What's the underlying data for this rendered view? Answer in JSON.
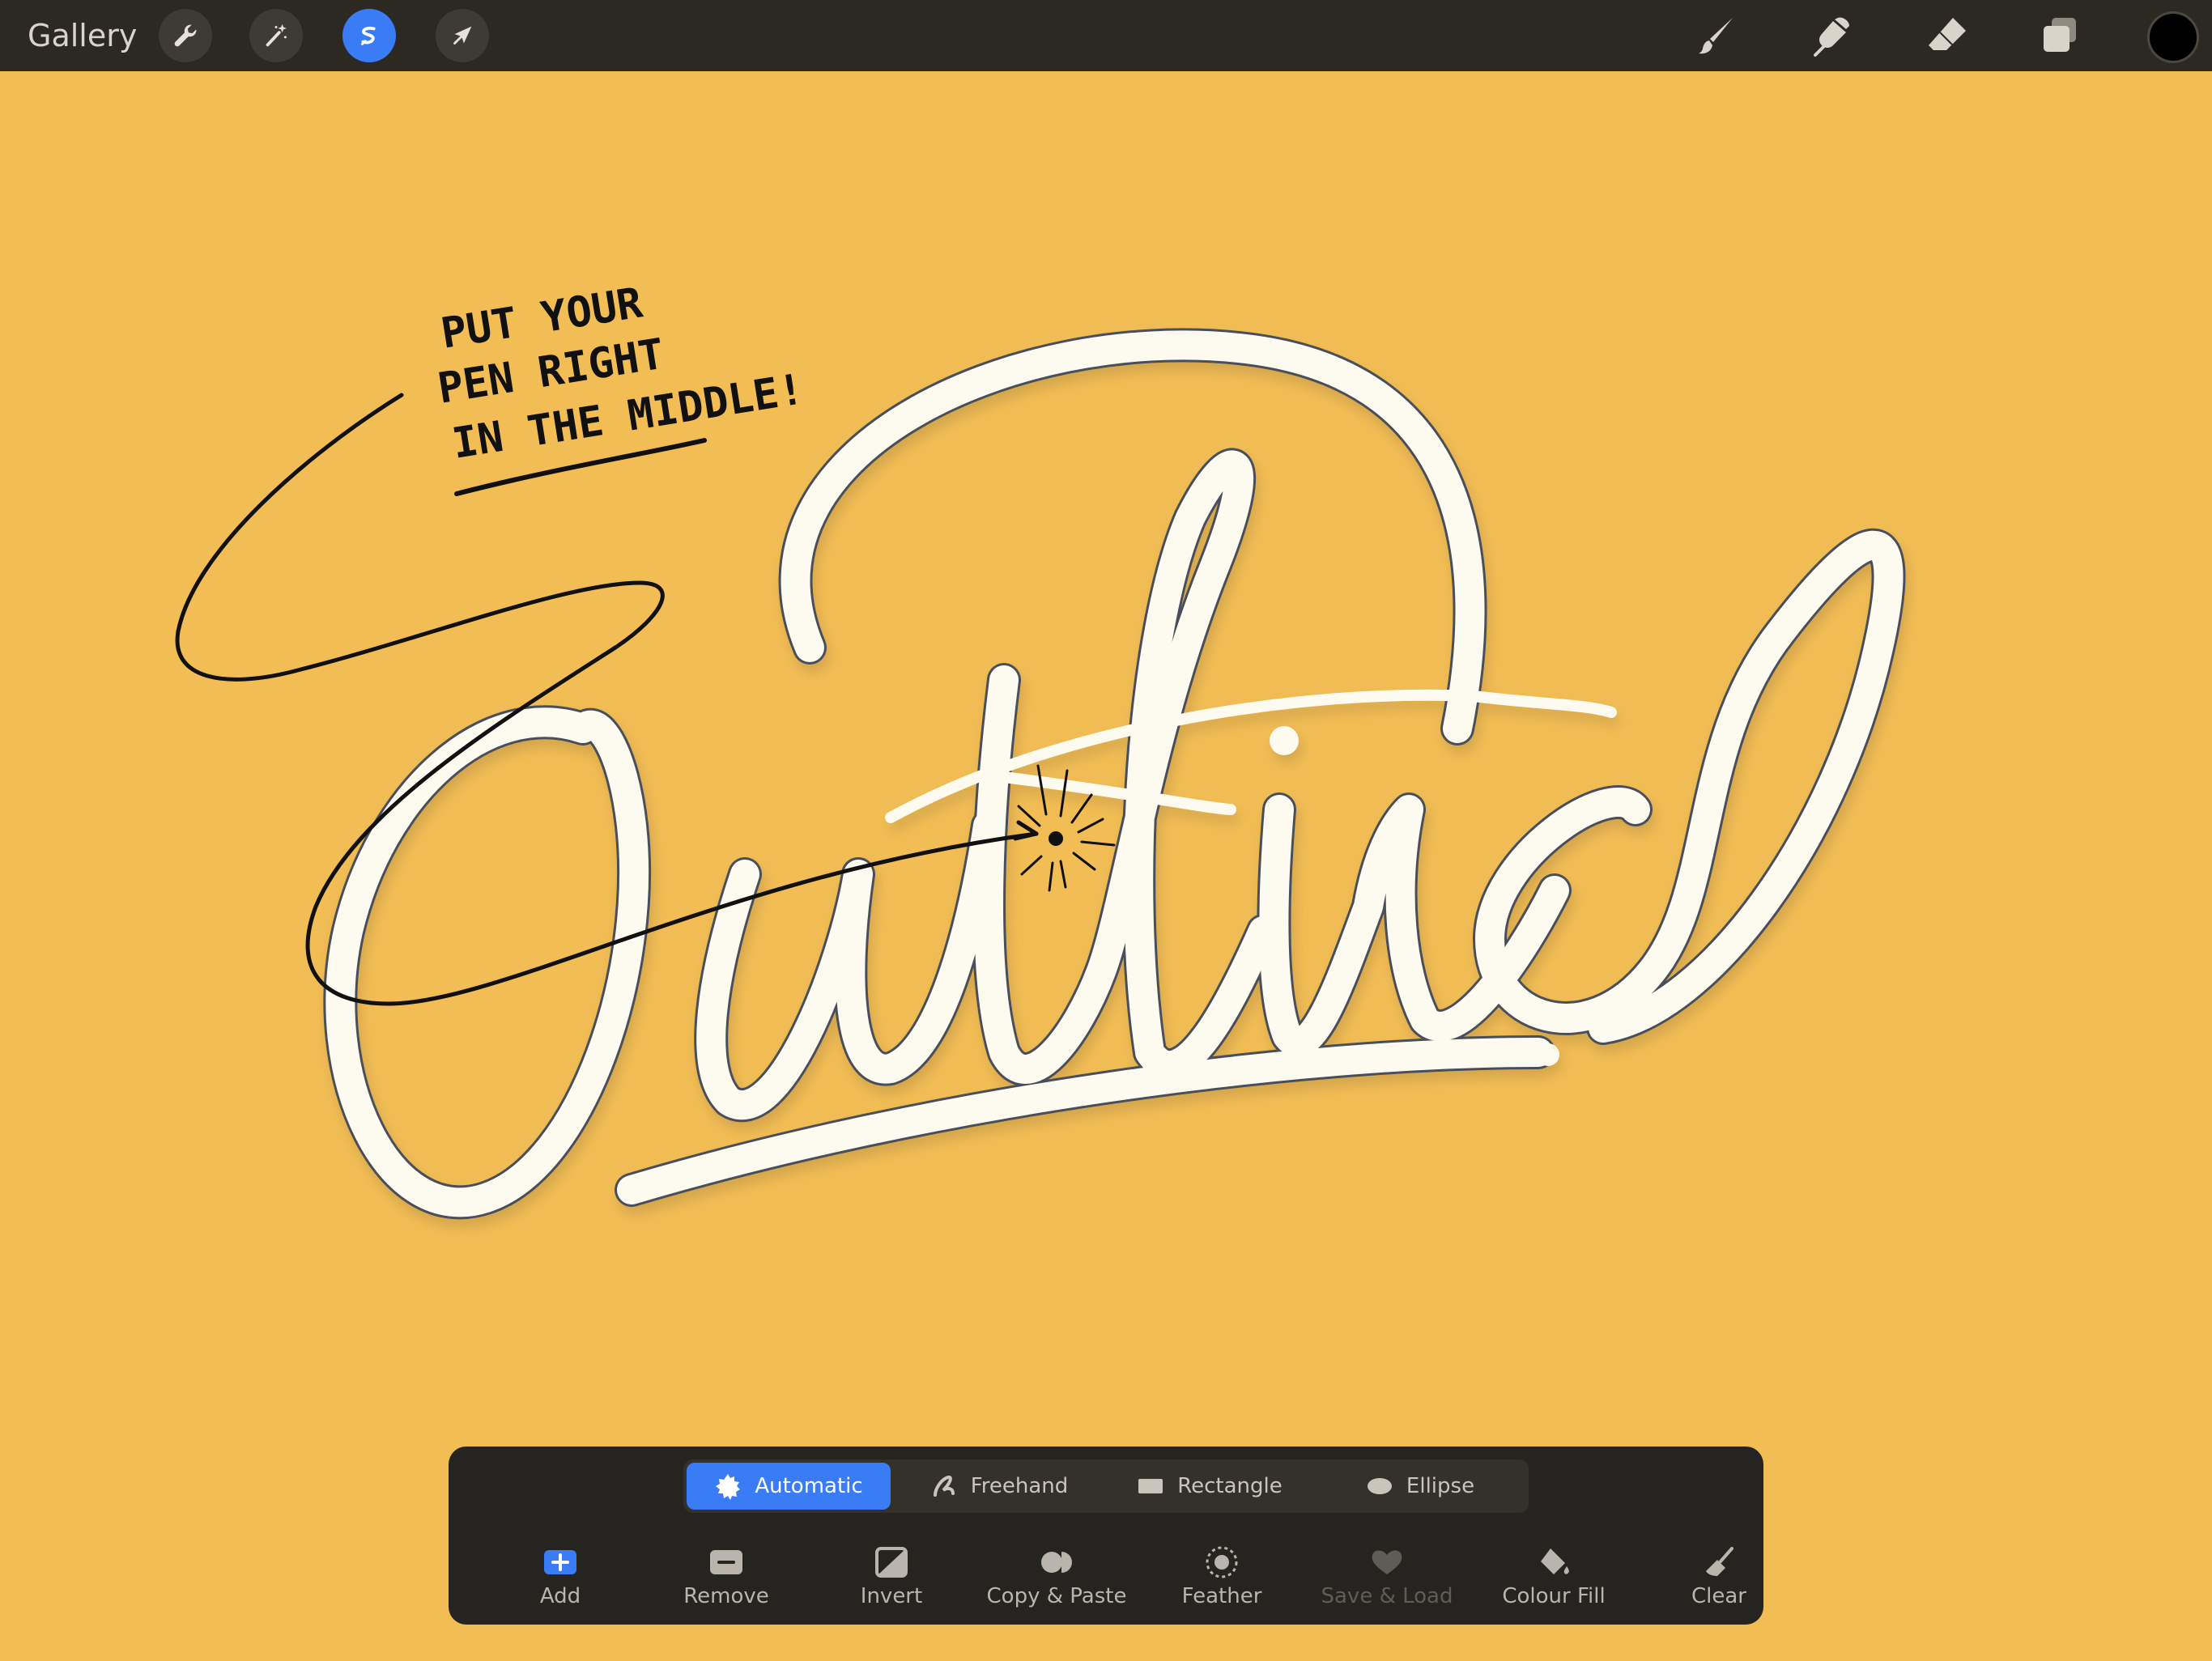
{
  "topbar": {
    "gallery_label": "Gallery",
    "left_tools": [
      "wrench-icon",
      "magic-wand-icon",
      "selection-icon",
      "transform-arrow-icon"
    ],
    "active_tool": "selection-icon",
    "right_tools": [
      "brush-icon",
      "smudge-icon",
      "eraser-icon",
      "layers-icon"
    ],
    "current_color": "#000000"
  },
  "canvas": {
    "background": "#F2BD55",
    "lettering": "Outline",
    "annotation_lines": [
      "PUT YOUR",
      "PEN RIGHT",
      "IN THE MIDDLE!"
    ]
  },
  "selection": {
    "modes": [
      {
        "label": "Automatic",
        "icon": "automatic-icon",
        "active": true
      },
      {
        "label": "Freehand",
        "icon": "freehand-icon",
        "active": false
      },
      {
        "label": "Rectangle",
        "icon": "rectangle-icon",
        "active": false
      },
      {
        "label": "Ellipse",
        "icon": "ellipse-icon",
        "active": false
      }
    ],
    "actions": [
      {
        "label": "Add",
        "icon": "add-icon",
        "enabled": true
      },
      {
        "label": "Remove",
        "icon": "remove-icon",
        "enabled": true
      },
      {
        "label": "Invert",
        "icon": "invert-icon",
        "enabled": true
      },
      {
        "label": "Copy & Paste",
        "icon": "copy-paste-icon",
        "enabled": true
      },
      {
        "label": "Feather",
        "icon": "feather-icon",
        "enabled": true
      },
      {
        "label": "Save & Load",
        "icon": "heart-icon",
        "enabled": false
      },
      {
        "label": "Colour Fill",
        "icon": "colour-fill-icon",
        "enabled": true
      },
      {
        "label": "Clear",
        "icon": "clear-icon",
        "enabled": true
      }
    ]
  }
}
